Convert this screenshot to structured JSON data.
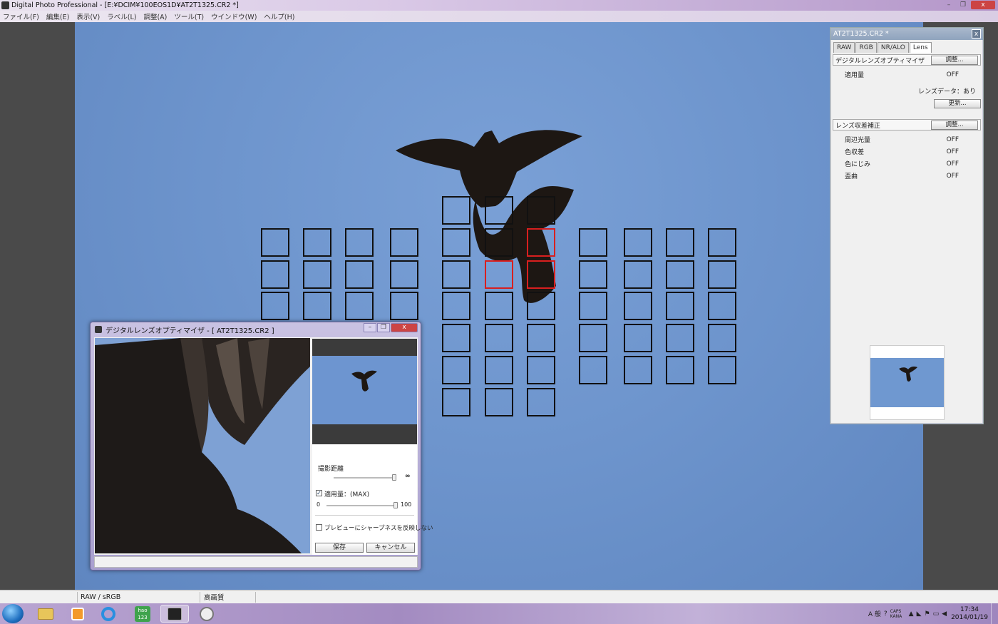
{
  "window": {
    "title": "Digital Photo Professional - [E:¥DCIM¥100EOS1D¥AT2T1325.CR2 *]",
    "minimize_glyph": "–",
    "maximize_glyph": "❐",
    "close_glyph": "x"
  },
  "menu": {
    "items": [
      "ファイル(F)",
      "編集(E)",
      "表示(V)",
      "ラベル(L)",
      "調整(A)",
      "ツール(T)",
      "ウインドウ(W)",
      "ヘルプ(H)"
    ]
  },
  "palette": {
    "title": "AT2T1325.CR2 *",
    "close_glyph": "x",
    "tabs": [
      "RAW",
      "RGB",
      "NR/ALO",
      "Lens"
    ],
    "active_tab": "Lens",
    "dlo_section": {
      "label": "デジタルレンズオプティマイザ",
      "button": "調整...",
      "amount_label": "適用量",
      "amount_value": "OFF",
      "lens_data": "レンズデータ：あり",
      "update_button": "更新..."
    },
    "aberration_section": {
      "label": "レンズ収差補正",
      "button": "調整...",
      "rows": [
        {
          "label": "周辺光量",
          "value": "OFF"
        },
        {
          "label": "色収差",
          "value": "OFF"
        },
        {
          "label": "色にじみ",
          "value": "OFF"
        },
        {
          "label": "歪曲",
          "value": "OFF"
        }
      ]
    }
  },
  "dlo_dialog": {
    "title": "デジタルレンズオプティマイザ - [ AT2T1325.CR2 ]",
    "distance_label": "撮影距離",
    "distance_value": "∞",
    "amount_checked": true,
    "amount_label": "適用量：(MAX)",
    "amount_min": "0",
    "amount_max": "100",
    "amount": 100,
    "preview_checked": false,
    "preview_label": "プレビューにシャープネスを反映しない",
    "save_button": "保存",
    "cancel_button": "キャンセル"
  },
  "statusbar": {
    "format": "RAW / sRGB",
    "quality": "高画質"
  },
  "taskbar": {
    "icons": [
      "windows-start-icon",
      "folder-icon",
      "media-player-icon",
      "internet-explorer-icon",
      "hao123-icon",
      "digital-photo-professional-icon",
      "paint-icon"
    ],
    "hao_label": "hao 123",
    "tray_ime": "A 般",
    "tray_caps": "CAPS KANA",
    "time": "17:34",
    "date": "2014/01/19"
  },
  "af_grid": {
    "active_points": [
      "r1c7",
      "r2c6",
      "r2c7"
    ]
  }
}
